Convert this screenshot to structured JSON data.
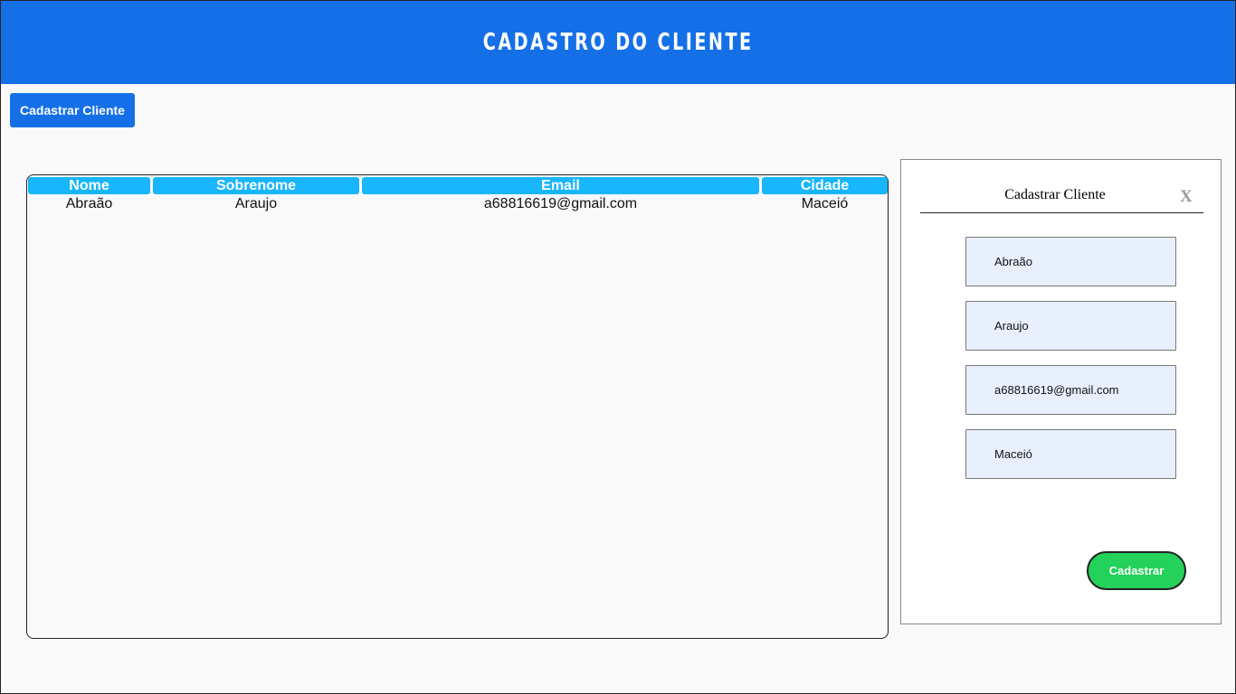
{
  "header": {
    "title": "CADASTRO DO CLIENTE"
  },
  "toolbar": {
    "open_form_label": "Cadastrar Cliente"
  },
  "table": {
    "columns": [
      "Nome",
      "Sobrenome",
      "Email",
      "Cidade"
    ],
    "rows": [
      [
        "Abraão",
        "Araujo",
        "a68816619@gmail.com",
        "Maceió"
      ]
    ]
  },
  "modal": {
    "title": "Cadastrar Cliente",
    "close_label": "X",
    "fields": {
      "nome": "Abraão",
      "sobrenome": "Araujo",
      "email": "a68816619@gmail.com",
      "cidade": "Maceió"
    },
    "submit_label": "Cadastrar"
  },
  "colors": {
    "header_bg": "#1570e8",
    "table_header_bg": "#18b6fc",
    "submit_bg": "#24d15a",
    "field_bg": "#e8f0fe"
  }
}
